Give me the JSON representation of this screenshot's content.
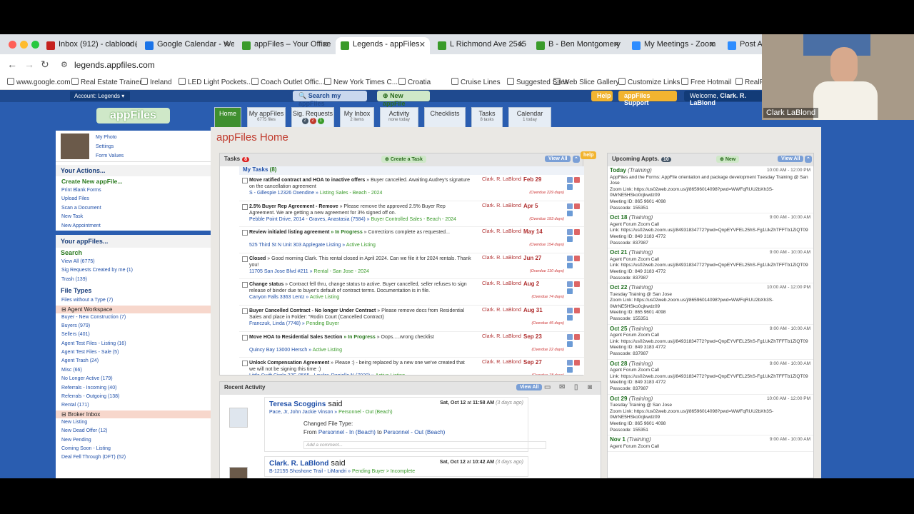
{
  "browser": {
    "tabs": [
      {
        "label": "Inbox (912) - clablond@",
        "color": "#c5221f"
      },
      {
        "label": "Google Calendar - Wee",
        "color": "#1a73e8"
      },
      {
        "label": "appFiles – Your Office I",
        "color": "#3a9b2a"
      },
      {
        "label": "Legends - appFiles",
        "color": "#3a9b2a"
      },
      {
        "label": "L Richmond Ave 2545 I",
        "color": "#3a9b2a"
      },
      {
        "label": "B - Ben Montgomery",
        "color": "#3a9b2a"
      },
      {
        "label": "My Meetings - Zoom",
        "color": "#2d8cff"
      },
      {
        "label": "Post Att",
        "color": "#2d8cff"
      }
    ],
    "url": "legends.appfiles.com",
    "bookmarks": [
      "www.google.com",
      "Real Estate Trainer",
      "Ireland",
      "LED Light Pockets...",
      "Coach Outlet Offic...",
      "New York Times C...",
      "Croatia",
      "Cruise Lines",
      "Suggested Sites",
      "Web Slice Gallery",
      "Customize Links",
      "Free Hotmail",
      "RealPla"
    ]
  },
  "topnav": {
    "account": "Account: Legends",
    "search": "Search my appFiles",
    "new_appfile": "New appFile",
    "help": "Help",
    "support": "appFiles Support",
    "welcome_prefix": "Welcome, ",
    "welcome_name": "Clark. R. LaBlond"
  },
  "logo": "appFiles",
  "apptabs": [
    {
      "label": "Home",
      "sub": ""
    },
    {
      "label": "My appFiles",
      "sub": "6775 files"
    },
    {
      "label": "Sig. Requests",
      "sub": ""
    },
    {
      "label": "My Inbox",
      "sub": "2 items"
    },
    {
      "label": "Activity",
      "sub": "none today"
    },
    {
      "label": "Checklists",
      "sub": ""
    },
    {
      "label": "Tasks",
      "sub": "8 tasks"
    },
    {
      "label": "Calendar",
      "sub": "1 today"
    }
  ],
  "sig_badges": [
    "2",
    "2",
    "1"
  ],
  "left": {
    "photo_links": [
      "My Photo",
      "Settings",
      "Form Values"
    ],
    "actions_title": "Your Actions...",
    "create_new": "Create New appFile...",
    "actions": [
      "Print Blank Forms",
      "Upload Files",
      "Scan a Document",
      "New Task",
      "New Appointment"
    ],
    "appfiles_title": "Your appFiles...",
    "search": "Search",
    "search_links": [
      "View All (6775)",
      "Sig Requests Created by me (1)",
      "Trash (139)"
    ],
    "file_types_title": "File Types",
    "file_types": [
      "Files without a Type (7)"
    ],
    "agent_workspace": "Agent Workspace",
    "agent_items": [
      "Buyer - New Construction (7)",
      "Buyers (979)",
      "Sellers (401)",
      "Agent Test Files - Listing (16)",
      "Agent Test Files - Sale (5)",
      "Agent Trash (24)",
      "Misc (66)",
      "No Longer Active (179)",
      "Referrals - Incoming (40)",
      "Referrals - Outgoing (138)",
      "Rental (171)"
    ],
    "broker_inbox": "Broker Inbox",
    "broker_items": [
      "New Listing",
      "New Dead Offer (12)",
      "New Pending",
      "Coming Soon - Listing",
      "Deal Fell Through (DFT) (52)"
    ]
  },
  "main": {
    "title": "appFiles Home",
    "tasks": {
      "title": "Tasks",
      "count": "8",
      "create": "Create a Task",
      "view_all": "View All",
      "help": "help",
      "my_tasks": "My Tasks",
      "my_tasks_count": "(8)",
      "items": [
        {
          "title": "Move ratified contract and HOA to inactive offers",
          "status": "",
          "note": "» Buyer cancelled. Awaiting Audrey's signature on the cancellation agreement",
          "who": "Clark. R. LaBlond",
          "due": "Feb 29",
          "overdue": "(Overdue 229 days)",
          "link": "S - Gillespie 12326 Oxendine »",
          "folder": "Listing Sales - Beach - 2024"
        },
        {
          "title": "2.5% Buyer Rep Agreement - Remove",
          "status": "",
          "note": "» Please remove the approved 2.5% Buyer Rep Agreement. We are getting a new agreement for 3% signed off on.",
          "who": "Clark. R. LaBlond",
          "due": "Apr 5",
          "overdue": "(Overdue 193 days)",
          "link": "Pebble Point Drive, 2014 - Graves, Anastasia (7584) »",
          "folder": "Buyer Controlled Sales - Beach - 2024"
        },
        {
          "title": "Review initialed listing agreement",
          "status": "» In Progress",
          "note": "» Corrections complete as requested...",
          "who": "Clark. R. LaBlond",
          "due": "May 14",
          "overdue": "(Overdue 154 days)",
          "link": "525 Third St N Unit 303 Applegate Listing »",
          "folder": "Active Listing"
        },
        {
          "title": "Closed",
          "status": "",
          "note": "» Good morning Clark. This rental closed in April 2024. Can we file it for 2024 rentals. Thank you!",
          "who": "Clark. R. LaBlond",
          "due": "Jun 27",
          "overdue": "(Overdue 110 days)",
          "link": "11705 San Jose Blvd #211 »",
          "folder": "Rental - San Jose - 2024"
        },
        {
          "title": "Change status",
          "status": "",
          "note": "» Contract fell thru, change status to active. Buyer cancelled, seller refuses to sign release of binder due to buyer's default of contract terms. Documentation is in file.",
          "who": "Clark. R. LaBlond",
          "due": "Aug 2",
          "overdue": "(Overdue 74 days)",
          "link": "Canyon Falls 3363 Lentz »",
          "folder": "Active Listing"
        },
        {
          "title": "Buyer Cancelled Contract - No longer Under Contract",
          "status": "",
          "note": "» Please remove docs from Residential Sales and place in Folder: \"Rodin Court (Cancelled Contract)",
          "who": "Clark. R. LaBlond",
          "due": "Aug 31",
          "overdue": "(Overdue 45 days)",
          "link": "Franczuk, Linda (7748) »",
          "folder": "Pending Buyer"
        },
        {
          "title": "Move HOA to Residential Sales Section",
          "status": "» In Progress",
          "note": "» Oops.....wrong checklist",
          "who": "Clark. R. LaBlond",
          "due": "Sep 23",
          "overdue": "(Overdue 22 days)",
          "link": "Quincy Bay 13000 Hersch »",
          "folder": "Active Listing"
        },
        {
          "title": "Unlock Compensation Agreement",
          "status": "",
          "note": "» Please :) - being replaced by a new one we've created that we will not be signing this time :)",
          "who": "Clark. R. LaBlond",
          "due": "Sep 27",
          "overdue": "(Overdue 18 days)",
          "link": "Little Swift Circle 32F, 8565 - Lawler, Danielle N (7920) »",
          "folder": "Active Listing"
        }
      ]
    },
    "appts": {
      "title": "Upcoming Appts.",
      "count": "10",
      "new": "New",
      "view_all": "View All",
      "items": [
        {
          "date": "Today",
          "type": "(Training)",
          "time": "10:00 AM - 12:00 PM",
          "lines": [
            "AppFiles and the Forms: AppFile orientation and package development Tuesday Training @ San Jose",
            "Zoom Link: https://us02web.zoom.us/j/86596014098?pwd=WWFqRUU2bXh3S-0MrNE5HSko0cjkwdz09",
            "Meeting ID: 865 9601 4098",
            "Passcode: 155351"
          ]
        },
        {
          "date": "Oct 18",
          "type": "(Training)",
          "time": "9:00 AM - 10:00 AM",
          "lines": [
            "Agent Forum Zoom Call",
            "Link: https://us02web.zoom.us/j/84931834772?pwd=QnpEYVFEL25hS-Fg1UkZhTFFTb1ZiQT09",
            "Meeting ID: 849 3183 4772",
            "Passcode: 837987"
          ]
        },
        {
          "date": "Oct 21",
          "type": "(Training)",
          "time": "9:00 AM - 10:00 AM",
          "lines": [
            "Agent Forum Zoom Call",
            "Link: https://us02web.zoom.us/j/84931834772?pwd=QnpEYVFEL25hS-Fg1UkZhTFFTb1ZiQT09",
            "Meeting ID: 849 3183 4772",
            "Passcode: 837987"
          ]
        },
        {
          "date": "Oct 22",
          "type": "(Training)",
          "time": "10:00 AM - 12:00 PM",
          "lines": [
            "Tuesday Training @ San Jose",
            "Zoom Link: https://us02web.zoom.us/j/86596014098?pwd=WWFqRUU2bXh3S-0MrNE5HSko0cjkwdz09",
            "Meeting ID: 865 9601 4098",
            "Passcode: 155351"
          ]
        },
        {
          "date": "Oct 25",
          "type": "(Training)",
          "time": "9:00 AM - 10:00 AM",
          "lines": [
            "Agent Forum Zoom Call",
            "Link: https://us02web.zoom.us/j/84931834772?pwd=QnpEYVFEL25hS-Fg1UkZhTFFTb1ZiQT09",
            "Meeting ID: 849 3183 4772",
            "Passcode: 837987"
          ]
        },
        {
          "date": "Oct 28",
          "type": "(Training)",
          "time": "9:00 AM - 10:00 AM",
          "lines": [
            "Agent Forum Zoom Call",
            "Link: https://us02web.zoom.us/j/84931834772?pwd=QnpEYVFEL25hS-Fg1UkZhTFFTb1ZiQT09",
            "Meeting ID: 849 3183 4772",
            "Passcode: 837987"
          ]
        },
        {
          "date": "Oct 29",
          "type": "(Training)",
          "time": "10:00 AM - 12:00 PM",
          "lines": [
            "Tuesday Training @ San Jose",
            "Zoom Link: https://us02web.zoom.us/j/86596014098?pwd=WWFqRUU2bXh3S-0MrNE5HSko0cjkwdz09",
            "Meeting ID: 865 9601 4098",
            "Passcode: 155351"
          ]
        },
        {
          "date": "Nov 1",
          "type": "(Training)",
          "time": "9:00 AM - 10:00 AM",
          "lines": [
            "Agent Forum Zoom Call"
          ]
        }
      ]
    },
    "activity": {
      "title": "Recent Activity",
      "view_all": "View All",
      "entries": [
        {
          "name": "Teresa Scoggins",
          "said": "said",
          "date": "Sat, Oct 12",
          "at": "at",
          "time": "11:58 AM",
          "ago": "(3 days ago)",
          "link": "Pace, Jr, John Jackie Vinson »",
          "folder": "Personnel - Out (Beach)",
          "change": "Changed File Type:",
          "from_label": "From",
          "from": "Personnel - In (Beach)",
          "to_label": "to",
          "to": "Personnel - Out (Beach)",
          "comment": "Add a comment..."
        },
        {
          "name": "Clark. R. LaBlond",
          "said": "said",
          "date": "Sat, Oct 12",
          "at": "at",
          "time": "10:42 AM",
          "ago": "(3 days ago)",
          "link": "B-12155 Shoshone Trail - LiMandri »",
          "folder": "Pending Buyer > Incomplete"
        }
      ]
    }
  },
  "video": {
    "name": "Clark LaBlond"
  },
  "colors": {
    "brand_green": "#3f8f2f",
    "site_blue": "#2a5db0",
    "overdue_red": "#cc3333",
    "link_blue": "#1f4fa8"
  }
}
